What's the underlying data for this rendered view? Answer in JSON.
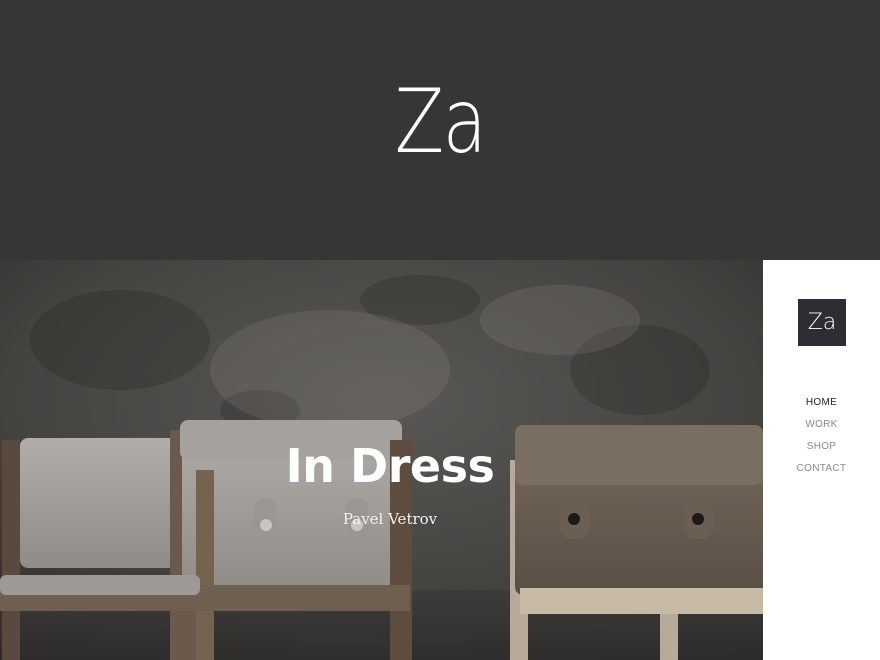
{
  "header": {
    "logo_text": "Za"
  },
  "hero": {
    "title": "In Dress",
    "author": "Pavel Vetrov"
  },
  "side_menu": {
    "logo_text": "Za",
    "items": [
      {
        "label": "HOME",
        "active": true
      },
      {
        "label": "WORK",
        "active": false
      },
      {
        "label": "SHOP",
        "active": false
      },
      {
        "label": "CONTACT",
        "active": false
      }
    ]
  },
  "colors": {
    "header_bg": "#383634",
    "panel_bg": "#ffffff",
    "logo_box_bg": "#2e2d33",
    "nav_active": "#222222",
    "nav_inactive": "#8a8a8a"
  }
}
